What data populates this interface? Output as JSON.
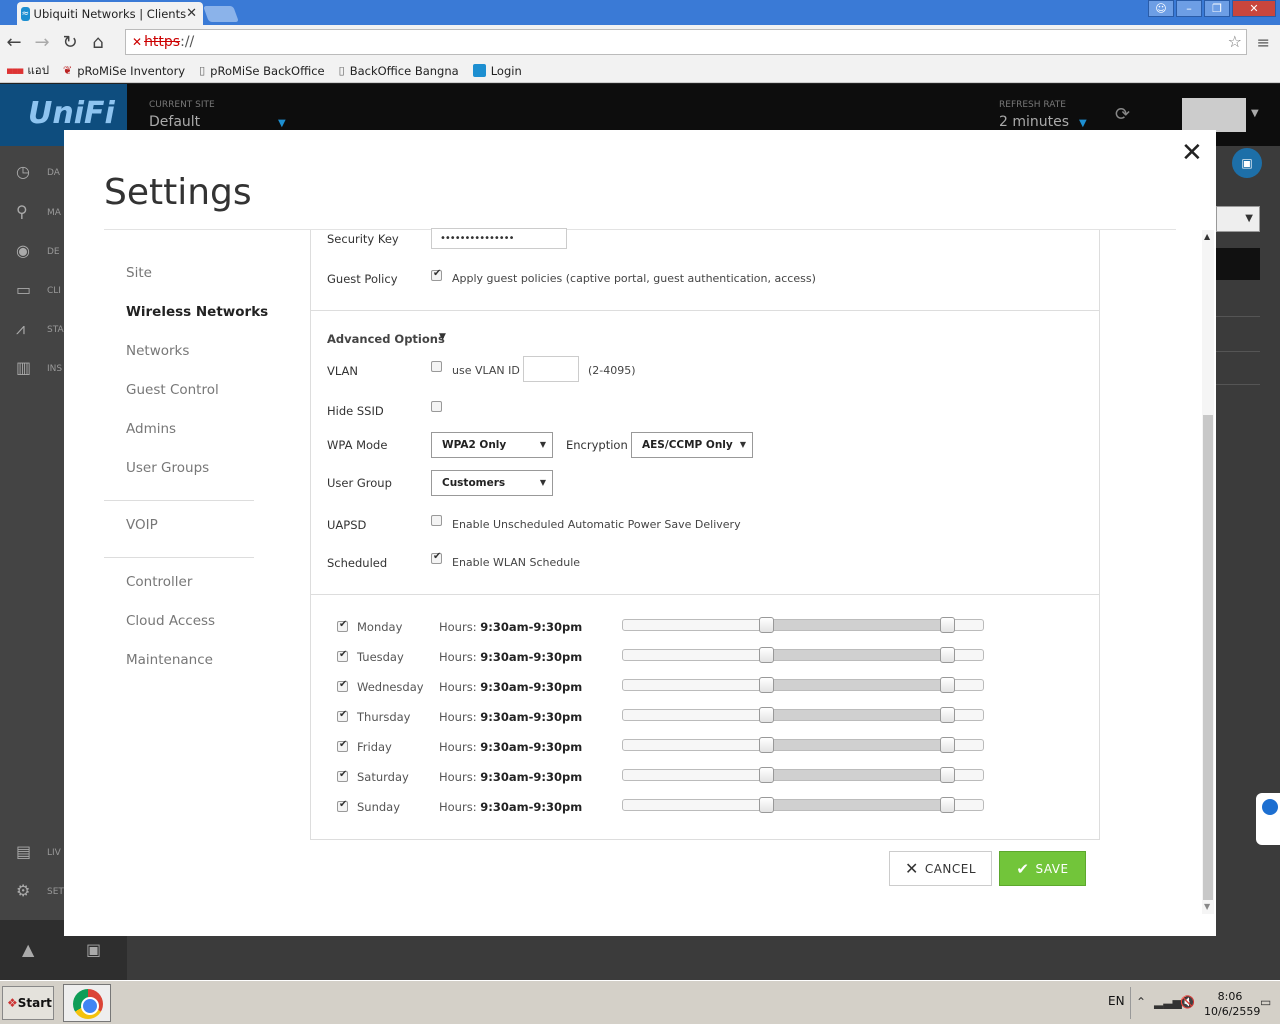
{
  "browser": {
    "tab_title": "Ubiquiti Networks | Clients",
    "url_protocol": "https",
    "url_rest": "://",
    "bookmarks": [
      {
        "label": "แอป",
        "icon": "apps-grid-icon"
      },
      {
        "label": "pRoMiSe Inventory",
        "icon": "promise-icon"
      },
      {
        "label": "pRoMiSe BackOffice",
        "icon": "page-icon"
      },
      {
        "label": "BackOffice Bangna",
        "icon": "page-icon"
      },
      {
        "label": "Login",
        "icon": "unifi-icon"
      }
    ]
  },
  "app": {
    "logo": "UniFi",
    "current_site_label": "CURRENT SITE",
    "current_site": "Default",
    "refresh_label": "REFRESH RATE",
    "refresh_value": "2 minutes",
    "side_labels": [
      "DA",
      "MA",
      "DE",
      "CLI",
      "STA",
      "INS",
      "LIV",
      "SET"
    ]
  },
  "modal": {
    "title": "Settings",
    "menu": [
      {
        "label": "Site",
        "active": false
      },
      {
        "label": "Wireless Networks",
        "active": true
      },
      {
        "label": "Networks",
        "active": false
      },
      {
        "label": "Guest Control",
        "active": false
      },
      {
        "label": "Admins",
        "active": false
      },
      {
        "label": "User Groups",
        "active": false
      },
      {
        "label": "VOIP",
        "active": false
      },
      {
        "label": "Controller",
        "active": false
      },
      {
        "label": "Cloud Access",
        "active": false
      },
      {
        "label": "Maintenance",
        "active": false
      }
    ],
    "form": {
      "security_key_label": "Security Key",
      "security_key_value": "•••••••••••••••",
      "guest_policy_label": "Guest Policy",
      "guest_policy_text": "Apply guest policies (captive portal, guest authentication, access)",
      "guest_policy_checked": true,
      "advanced_label": "Advanced Options",
      "vlan_label": "VLAN",
      "vlan_text": "use VLAN ID",
      "vlan_range": "(2-4095)",
      "vlan_checked": false,
      "hide_ssid_label": "Hide SSID",
      "hide_ssid_checked": false,
      "wpa_mode_label": "WPA Mode",
      "wpa_mode_value": "WPA2 Only",
      "encryption_label": "Encryption",
      "encryption_value": "AES/CCMP Only",
      "user_group_label": "User Group",
      "user_group_value": "Customers",
      "uapsd_label": "UAPSD",
      "uapsd_text": "Enable Unscheduled Automatic Power Save Delivery",
      "uapsd_checked": false,
      "scheduled_label": "Scheduled",
      "scheduled_text": "Enable WLAN Schedule",
      "scheduled_checked": true
    },
    "schedule": [
      {
        "day": "Monday",
        "hours_label": "Hours:",
        "hours": "9:30am-9:30pm",
        "checked": true,
        "start_frac": 0.395,
        "end_frac": 0.895
      },
      {
        "day": "Tuesday",
        "hours_label": "Hours:",
        "hours": "9:30am-9:30pm",
        "checked": true,
        "start_frac": 0.395,
        "end_frac": 0.895
      },
      {
        "day": "Wednesday",
        "hours_label": "Hours:",
        "hours": "9:30am-9:30pm",
        "checked": true,
        "start_frac": 0.395,
        "end_frac": 0.895
      },
      {
        "day": "Thursday",
        "hours_label": "Hours:",
        "hours": "9:30am-9:30pm",
        "checked": true,
        "start_frac": 0.395,
        "end_frac": 0.895
      },
      {
        "day": "Friday",
        "hours_label": "Hours:",
        "hours": "9:30am-9:30pm",
        "checked": true,
        "start_frac": 0.395,
        "end_frac": 0.895
      },
      {
        "day": "Saturday",
        "hours_label": "Hours:",
        "hours": "9:30am-9:30pm",
        "checked": true,
        "start_frac": 0.395,
        "end_frac": 0.895
      },
      {
        "day": "Sunday",
        "hours_label": "Hours:",
        "hours": "9:30am-9:30pm",
        "checked": true,
        "start_frac": 0.395,
        "end_frac": 0.895
      }
    ],
    "cancel_label": "CANCEL",
    "save_label": "SAVE"
  },
  "taskbar": {
    "start_label": "Start",
    "lang": "EN",
    "time": "8:06",
    "date": "10/6/2559"
  },
  "colors": {
    "accent": "#1d8fd1",
    "save_green": "#72c53a"
  }
}
